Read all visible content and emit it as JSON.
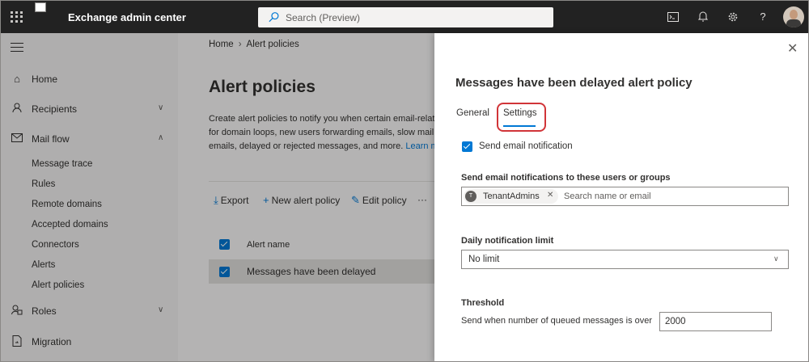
{
  "topbar": {
    "app_title": "Exchange admin center",
    "search_placeholder": "Search (Preview)",
    "icons": [
      "terminal-icon",
      "bell-icon",
      "gear-icon",
      "help-icon"
    ],
    "help_label": "?"
  },
  "sidebar": {
    "items": [
      {
        "label": "Home",
        "icon": "home-icon"
      },
      {
        "label": "Recipients",
        "icon": "person-icon"
      },
      {
        "label": "Mail flow",
        "icon": "mail-icon"
      },
      {
        "label": "Roles",
        "icon": "roles-icon"
      },
      {
        "label": "Migration",
        "icon": "migration-icon"
      }
    ],
    "mailflow_sub": [
      "Message trace",
      "Rules",
      "Remote domains",
      "Accepted domains",
      "Connectors",
      "Alerts",
      "Alert policies"
    ]
  },
  "main": {
    "breadcrumb": [
      "Home",
      "Alert policies"
    ],
    "title": "Alert policies",
    "description": [
      "Create alert policies to notify you when certain email-relat",
      "for domain loops, new users forwarding emails, slow mail",
      "emails, delayed or rejected messages, and more."
    ],
    "learn_more": "Learn mo",
    "commands": {
      "export": "Export",
      "new": "New alert policy",
      "edit": "Edit policy",
      "more": "···"
    },
    "column_header": "Alert name",
    "rows": [
      "Messages have been delayed"
    ]
  },
  "panel": {
    "title": "Messages have been delayed alert policy",
    "tabs": [
      "General",
      "Settings"
    ],
    "active_tab": "Settings",
    "send_email_notification": "Send email notification",
    "recipients_label": "Send email notifications to these users or groups",
    "recipient_pill": {
      "initial": "T",
      "name": "TenantAdmins"
    },
    "recipient_placeholder": "Search name or email",
    "daily_limit_label": "Daily notification limit",
    "daily_limit_value": "No limit",
    "threshold_heading": "Threshold",
    "threshold_label": "Send when number of queued messages is over",
    "threshold_value": "2000"
  },
  "colors": {
    "accent": "#0078d4",
    "topbar": "#222222",
    "highlight": "#d13438"
  }
}
